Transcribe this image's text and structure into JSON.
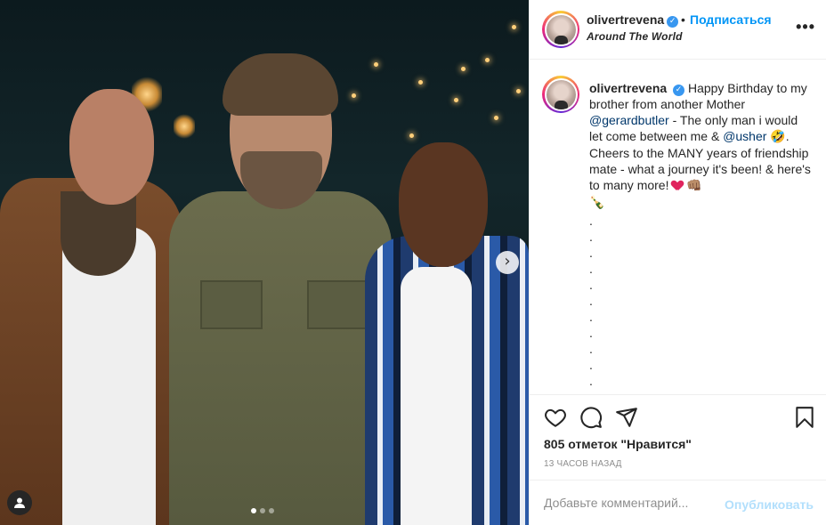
{
  "post": {
    "username": "olivertrevena",
    "verified_mark": "✓",
    "separator": "•",
    "follow_label": "Подписаться",
    "location": "Around The World",
    "more_label": "•••",
    "carousel": {
      "next_symbol": "›",
      "slides": 3,
      "active_slide": 1
    }
  },
  "caption": {
    "username": "olivertrevena",
    "part1": "Happy Birthday to my brother from another Mother ",
    "mention1": "@gerardbutler",
    "part2": " - The only man i would let come between me & ",
    "mention2": "@usher",
    "emoji1": "🤣",
    "part3": ". Cheers to the MANY years of friendship mate - what a journey it's been! & here's to many more! ",
    "emoji2": "👊🏽",
    "emoji3": "🍾",
    "dots": [
      ".",
      ".",
      ".",
      ".",
      ".",
      ".",
      ".",
      ".",
      ".",
      ".",
      "."
    ]
  },
  "actions": {
    "like_icon": "heart-outline-icon",
    "comment_icon": "comment-icon",
    "share_icon": "paper-plane-icon",
    "save_icon": "bookmark-icon"
  },
  "likes": "805 отметок \"Нравится\"",
  "time": "13 часов назад",
  "comment": {
    "placeholder": "Добавьте комментарий...",
    "publish_label": "Опубликовать"
  },
  "colors": {
    "link_blue": "#0095f6",
    "mention": "#00376b",
    "publish_disabled": "#b2dffc",
    "verified": "#3897f0"
  }
}
